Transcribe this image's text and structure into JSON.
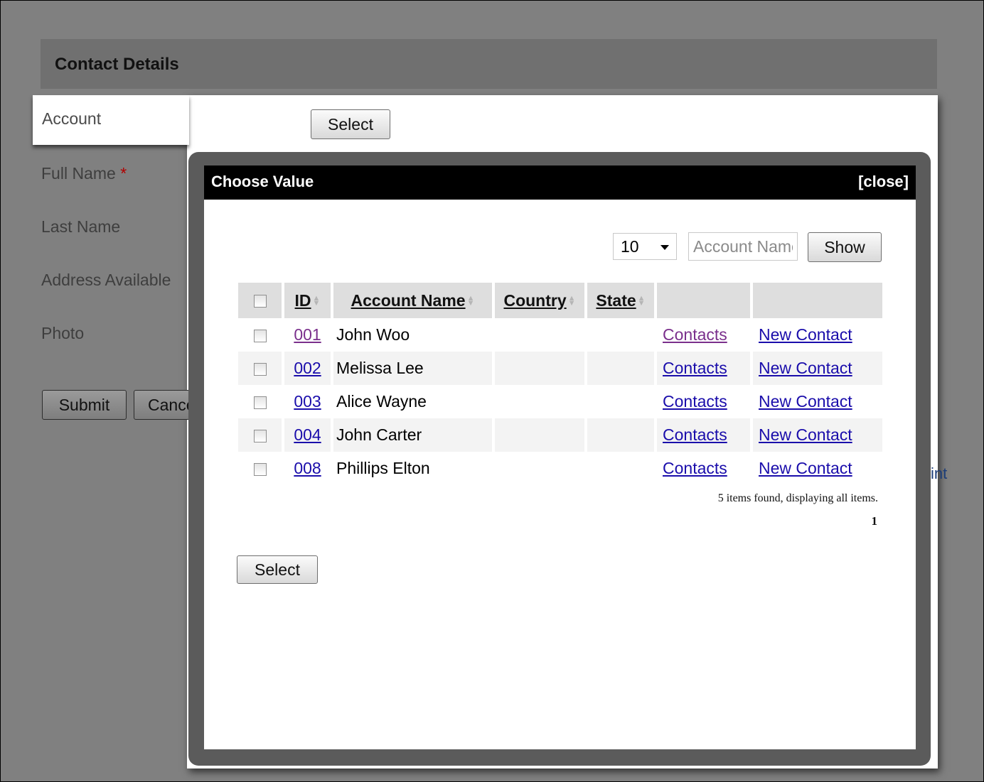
{
  "form": {
    "title": "Contact Details",
    "fields": {
      "account": "Account",
      "full_name": "Full Name",
      "required_mark": "*",
      "last_name": "Last Name",
      "address_available": "Address Available",
      "photo": "Photo"
    },
    "select_label": "Select",
    "submit_label": "Submit",
    "cancel_label": "Cancel",
    "print_label": "Print"
  },
  "modal": {
    "title": "Choose Value",
    "close_label": "[close]",
    "page_size": "10",
    "search_placeholder": "Account Name",
    "show_label": "Show",
    "select_label": "Select",
    "columns": [
      "ID",
      "Account Name",
      "Country",
      "State"
    ],
    "rows": [
      {
        "id": "001",
        "name": "John Woo",
        "country": "",
        "state": "",
        "contacts": "Contacts",
        "new_contact": "New Contact"
      },
      {
        "id": "002",
        "name": "Melissa Lee",
        "country": "",
        "state": "",
        "contacts": "Contacts",
        "new_contact": "New Contact"
      },
      {
        "id": "003",
        "name": "Alice Wayne",
        "country": "",
        "state": "",
        "contacts": "Contacts",
        "new_contact": "New Contact"
      },
      {
        "id": "004",
        "name": "John Carter",
        "country": "",
        "state": "",
        "contacts": "Contacts",
        "new_contact": "New Contact"
      },
      {
        "id": "008",
        "name": "Phillips Elton",
        "country": "",
        "state": "",
        "contacts": "Contacts",
        "new_contact": "New Contact"
      }
    ],
    "found_text": "5 items found, displaying all items.",
    "current_page": "1"
  }
}
